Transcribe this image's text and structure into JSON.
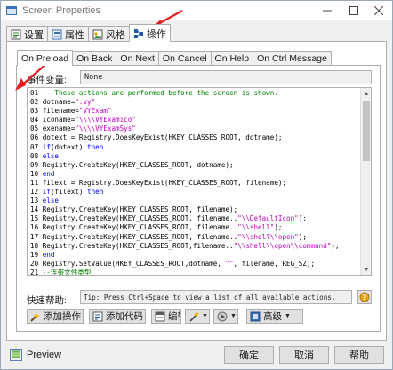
{
  "window": {
    "title": "Screen Properties"
  },
  "top_tabs": [
    {
      "label": "设置",
      "icon": "settings-icon"
    },
    {
      "label": "属性",
      "icon": "properties-icon"
    },
    {
      "label": "风格",
      "icon": "style-icon"
    },
    {
      "label": "操作",
      "icon": "actions-icon",
      "active": true
    }
  ],
  "event_tabs": [
    {
      "label": "On Preload",
      "active": true
    },
    {
      "label": "On Back"
    },
    {
      "label": "On Next"
    },
    {
      "label": "On Cancel"
    },
    {
      "label": "On Help"
    },
    {
      "label": "On Ctrl Message"
    }
  ],
  "event_variable": {
    "label": "事件变量:",
    "value": "None"
  },
  "code_lines": [
    [
      [
        "ln",
        "01 "
      ],
      [
        "cmt",
        "-- These actions are performed before the screen is shown."
      ]
    ],
    [
      [
        "ln",
        "02 "
      ],
      [
        "txt",
        "dotname="
      ],
      [
        "str",
        "\".vy\""
      ]
    ],
    [
      [
        "ln",
        "03 "
      ],
      [
        "txt",
        "filename="
      ],
      [
        "str",
        "\"VYExam\""
      ]
    ],
    [
      [
        "ln",
        "04 "
      ],
      [
        "txt",
        "iconame="
      ],
      [
        "str",
        "\"\\\\\\\\VYExamico\""
      ]
    ],
    [
      [
        "ln",
        "05 "
      ],
      [
        "txt",
        "exename="
      ],
      [
        "str",
        "\"\\\\\\\\VYExamSys\""
      ]
    ],
    [
      [
        "ln",
        "06 "
      ],
      [
        "txt",
        "dotext = Registry.DoesKeyExist(HKEY_CLASSES_ROOT, dotname);"
      ]
    ],
    [
      [
        "ln",
        "07 "
      ],
      [
        "kw",
        "if"
      ],
      [
        "txt",
        "(dotext) "
      ],
      [
        "kw",
        "then"
      ]
    ],
    [
      [
        "ln",
        "08 "
      ],
      [
        "kw",
        "else"
      ]
    ],
    [
      [
        "ln",
        "09 "
      ],
      [
        "txt",
        "Registry.CreateKey(HKEY_CLASSES_ROOT, dotname);"
      ]
    ],
    [
      [
        "ln",
        "10 "
      ],
      [
        "kw",
        "end"
      ]
    ],
    [
      [
        "ln",
        "11 "
      ],
      [
        "txt",
        "filext = Registry.DoesKeyExist(HKEY_CLASSES_ROOT, filename);"
      ]
    ],
    [
      [
        "ln",
        "12 "
      ],
      [
        "kw",
        "if"
      ],
      [
        "txt",
        "(filext) "
      ],
      [
        "kw",
        "then"
      ]
    ],
    [
      [
        "ln",
        "13 "
      ],
      [
        "kw",
        "else"
      ]
    ],
    [
      [
        "ln",
        "14 "
      ],
      [
        "txt",
        "Registry.CreateKey(HKEY_CLASSES_ROOT, filename);"
      ]
    ],
    [
      [
        "ln",
        "15 "
      ],
      [
        "txt",
        "Registry.CreateKey(HKEY_CLASSES_ROOT, filename.."
      ],
      [
        "str",
        "\"\\\\DefaultIcon\""
      ],
      [
        "txt",
        ");"
      ]
    ],
    [
      [
        "ln",
        "16 "
      ],
      [
        "txt",
        "Registry.CreateKey(HKEY_CLASSES_ROOT, filename.."
      ],
      [
        "str",
        "\"\\\\shell\""
      ],
      [
        "txt",
        ");"
      ]
    ],
    [
      [
        "ln",
        "17 "
      ],
      [
        "txt",
        "Registry.CreateKey(HKEY_CLASSES_ROOT, filename.."
      ],
      [
        "str",
        "\"\\\\shell\\\\open\""
      ],
      [
        "txt",
        ");"
      ]
    ],
    [
      [
        "ln",
        "18 "
      ],
      [
        "txt",
        "Registry.CreateKey(HKEY_CLASSES_ROOT,filename.."
      ],
      [
        "str",
        "\"\\\\shell\\\\open\\\\command\""
      ],
      [
        "txt",
        ");"
      ]
    ],
    [
      [
        "ln",
        "19 "
      ],
      [
        "kw",
        "end"
      ]
    ],
    [
      [
        "ln",
        "20 "
      ],
      [
        "txt",
        "Registry.SetValue(HKEY_CLASSES_ROOT,dotname, "
      ],
      [
        "str",
        "\"\""
      ],
      [
        "txt",
        ", filename, REG_SZ);"
      ]
    ],
    [
      [
        "ln",
        "21 "
      ],
      [
        "cmt",
        "--连带文件类型"
      ]
    ]
  ],
  "quick_help": {
    "label": "快速帮助:",
    "text": "Tip: Press Ctrl+Space to view a list of all available actions."
  },
  "action_buttons": [
    {
      "label": "添加操作",
      "icon": "add-action-icon"
    },
    {
      "label": "添加代码",
      "icon": "add-code-icon"
    },
    {
      "label": "编辑(E",
      "icon": "edit-icon"
    },
    {
      "label": "",
      "icon": "wizard-icon"
    },
    {
      "label": "",
      "icon": "script-icon"
    },
    {
      "label": "高级",
      "icon": "advanced-icon"
    }
  ],
  "bottom": {
    "preview_label": "Preview",
    "ok_label": "确定",
    "cancel_label": "取消",
    "help_label": "帮助"
  },
  "colors": {
    "keyword": "#0000ff",
    "string": "#c000c0",
    "comment": "#008000",
    "annotation_arrow": "#e02020"
  }
}
